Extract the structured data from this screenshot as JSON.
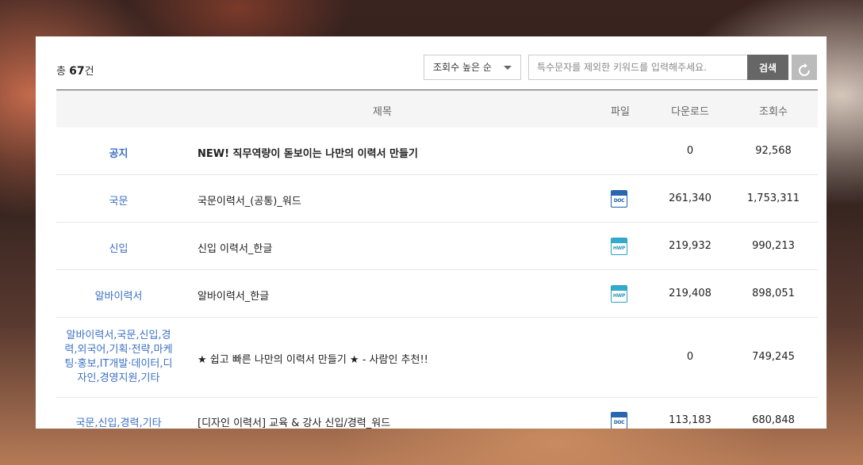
{
  "toolbar": {
    "total_prefix": "총 ",
    "total_count": "67",
    "total_suffix": "건",
    "sort_selected": "조회수 높은 순",
    "search_placeholder": "특수문자를 제외한 키워드를 입력해주세요.",
    "search_value": "",
    "search_label": "검색"
  },
  "table": {
    "headers": {
      "title": "제목",
      "file": "파일",
      "downloads": "다운로드",
      "views": "조회수"
    },
    "rows": [
      {
        "category": "공지",
        "title": "NEW! 직무역량이 돋보이는 나만의 이력서 만들기",
        "file": "",
        "downloads": "0",
        "views": "92,568"
      },
      {
        "category": "국문",
        "title": "국문이력서_(공통)_워드",
        "file": "DOC",
        "downloads": "261,340",
        "views": "1,753,311"
      },
      {
        "category": "신입",
        "title": "신입 이력서_한글",
        "file": "HWP",
        "downloads": "219,932",
        "views": "990,213"
      },
      {
        "category": "알바이력서",
        "title": "알바이력서_한글",
        "file": "HWP",
        "downloads": "219,408",
        "views": "898,051"
      },
      {
        "category_lines": [
          "알바이력서,국문,신입,경",
          "력,외국어,기획·전략,마케",
          "팅·홍보,IT개발·데이터,디",
          "자인,경영지원,기타"
        ],
        "title": "★ 쉽고 빠른 나만의 이력서 만들기 ★ - 사람인 추천!!",
        "file": "",
        "downloads": "0",
        "views": "749,245"
      },
      {
        "category": "국문,신입,경력,기타",
        "title": "[디자인 이력서] 교육 & 강사 신입/경력_워드",
        "file": "DOC",
        "downloads": "113,183",
        "views": "680,848"
      }
    ]
  },
  "colors": {
    "accent": "#3a6fc4",
    "search_button": "#666666"
  },
  "icons": {
    "reset": "refresh-icon",
    "sort": "chevron-down-icon"
  }
}
